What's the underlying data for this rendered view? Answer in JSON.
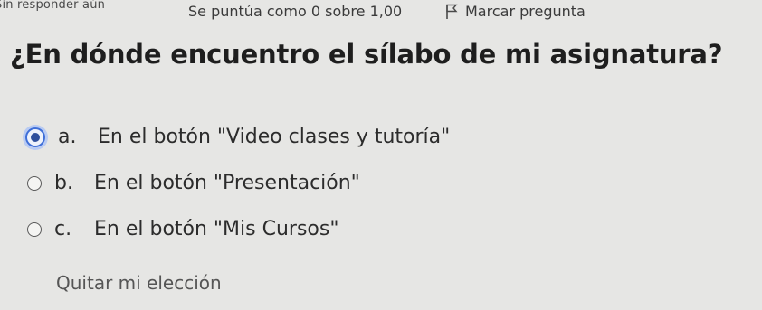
{
  "header": {
    "status": "Sin responder aún",
    "grade": "Se puntúa como 0 sobre 1,00",
    "flag_label": "Marcar pregunta"
  },
  "question": {
    "text": "¿En dónde encuentro el sílabo de mi asignatura?"
  },
  "answers": [
    {
      "letter": "a.",
      "text": "En el botón \"Video clases y tutoría\"",
      "selected": true
    },
    {
      "letter": "b.",
      "text": "En el botón \"Presentación\"",
      "selected": false
    },
    {
      "letter": "c.",
      "text": "En el botón \"Mis Cursos\"",
      "selected": false
    }
  ],
  "clear_choice_label": "Quitar mi elección",
  "colors": {
    "background": "#e6e6e4",
    "selected_ring": "#3f6fd8",
    "selected_dot": "#2e4f9c"
  }
}
